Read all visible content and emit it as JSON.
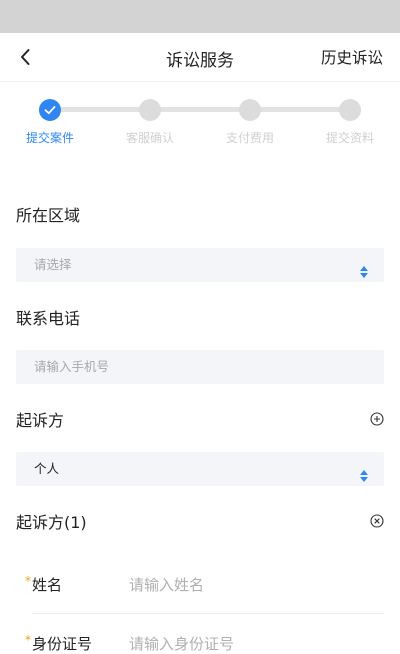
{
  "nav": {
    "title": "诉讼服务",
    "right_label": "历史诉讼"
  },
  "stepper": {
    "steps": [
      {
        "label": "提交案件",
        "active": true
      },
      {
        "label": "客服确认",
        "active": false
      },
      {
        "label": "支付费用",
        "active": false
      },
      {
        "label": "提交资料",
        "active": false
      }
    ],
    "accent_color": "#2f86f2"
  },
  "form": {
    "region": {
      "label": "所在区域",
      "placeholder": "请选择"
    },
    "phone": {
      "label": "联系电话",
      "placeholder": "请输入手机号"
    },
    "plaintiff": {
      "label": "起诉方",
      "value": "个人"
    },
    "plaintiff_item": {
      "title": "起诉方(1)",
      "required_mark": "*",
      "name": {
        "label": "姓名",
        "placeholder": "请输入姓名"
      },
      "id_number": {
        "label": "身份证号",
        "placeholder": "请输入身份证号"
      }
    }
  },
  "icons": {
    "back": "chevron-left-icon",
    "step_check": "check-icon",
    "select": "sort-arrows-icon",
    "add": "plus-circle-icon",
    "remove": "close-circle-icon"
  }
}
